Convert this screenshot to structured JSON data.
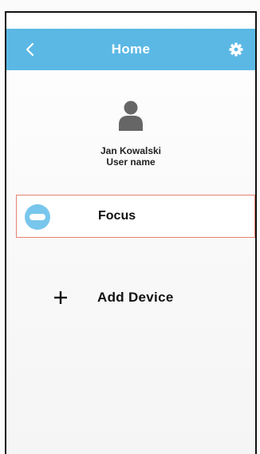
{
  "header": {
    "title": "Home",
    "back_icon": "chevron-left-icon",
    "settings_icon": "gear-icon",
    "background_color": "#5bb8e4"
  },
  "profile": {
    "avatar_icon": "user-avatar-icon",
    "name": "Jan Kowalski",
    "subtitle": "User name"
  },
  "devices": [
    {
      "name": "Focus",
      "icon": "device-icon",
      "icon_color": "#78c6ec",
      "border_color": "#e8826f"
    }
  ],
  "add_device": {
    "icon": "plus-icon",
    "label": "Add Device"
  }
}
